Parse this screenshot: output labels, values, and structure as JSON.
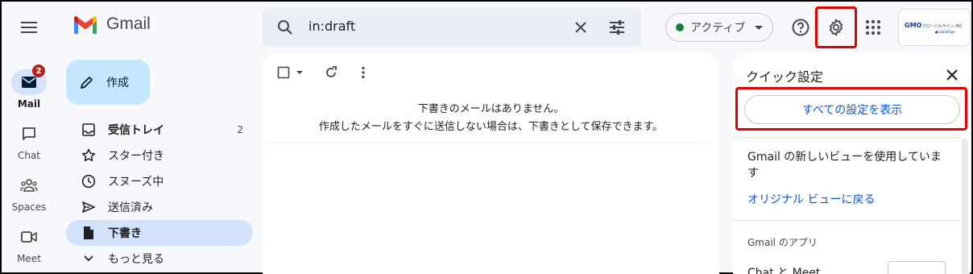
{
  "header": {
    "app_name": "Gmail",
    "search_value": "in:draft",
    "status_label": "アクティブ",
    "account_logo_text": "GMOグローバルサイン・HD"
  },
  "rail": [
    {
      "label": "Mail",
      "icon": "mail-icon",
      "badge": "2",
      "active": true
    },
    {
      "label": "Chat",
      "icon": "chat-icon"
    },
    {
      "label": "Spaces",
      "icon": "spaces-icon"
    },
    {
      "label": "Meet",
      "icon": "meet-icon"
    }
  ],
  "compose_label": "作成",
  "nav": [
    {
      "label": "受信トレイ",
      "icon": "inbox-icon",
      "count": "2"
    },
    {
      "label": "スター付き",
      "icon": "star-icon"
    },
    {
      "label": "スヌーズ中",
      "icon": "clock-icon"
    },
    {
      "label": "送信済み",
      "icon": "send-icon"
    },
    {
      "label": "下書き",
      "icon": "draft-icon"
    },
    {
      "label": "もっと見る",
      "icon": "chevron-down-icon"
    }
  ],
  "main": {
    "empty_title": "下書きのメールはありません。",
    "empty_desc": "作成したメールをすぐに送信しない場合は、下書きとして保存できます。"
  },
  "quick_settings": {
    "title": "クイック設定",
    "all_settings_button": "すべての設定を表示",
    "new_view_text": "Gmail の新しいビューを使用しています",
    "original_view_link": "オリジナル ビューに戻る",
    "apps_heading": "Gmail のアプリ",
    "chat_meet_label": "Chat と Meet"
  },
  "colors": {
    "highlight": "#e00000",
    "accent": "#0b57d0",
    "active_nav": "#d3e3fd",
    "compose": "#c2e7ff",
    "status_dot": "#188038"
  }
}
